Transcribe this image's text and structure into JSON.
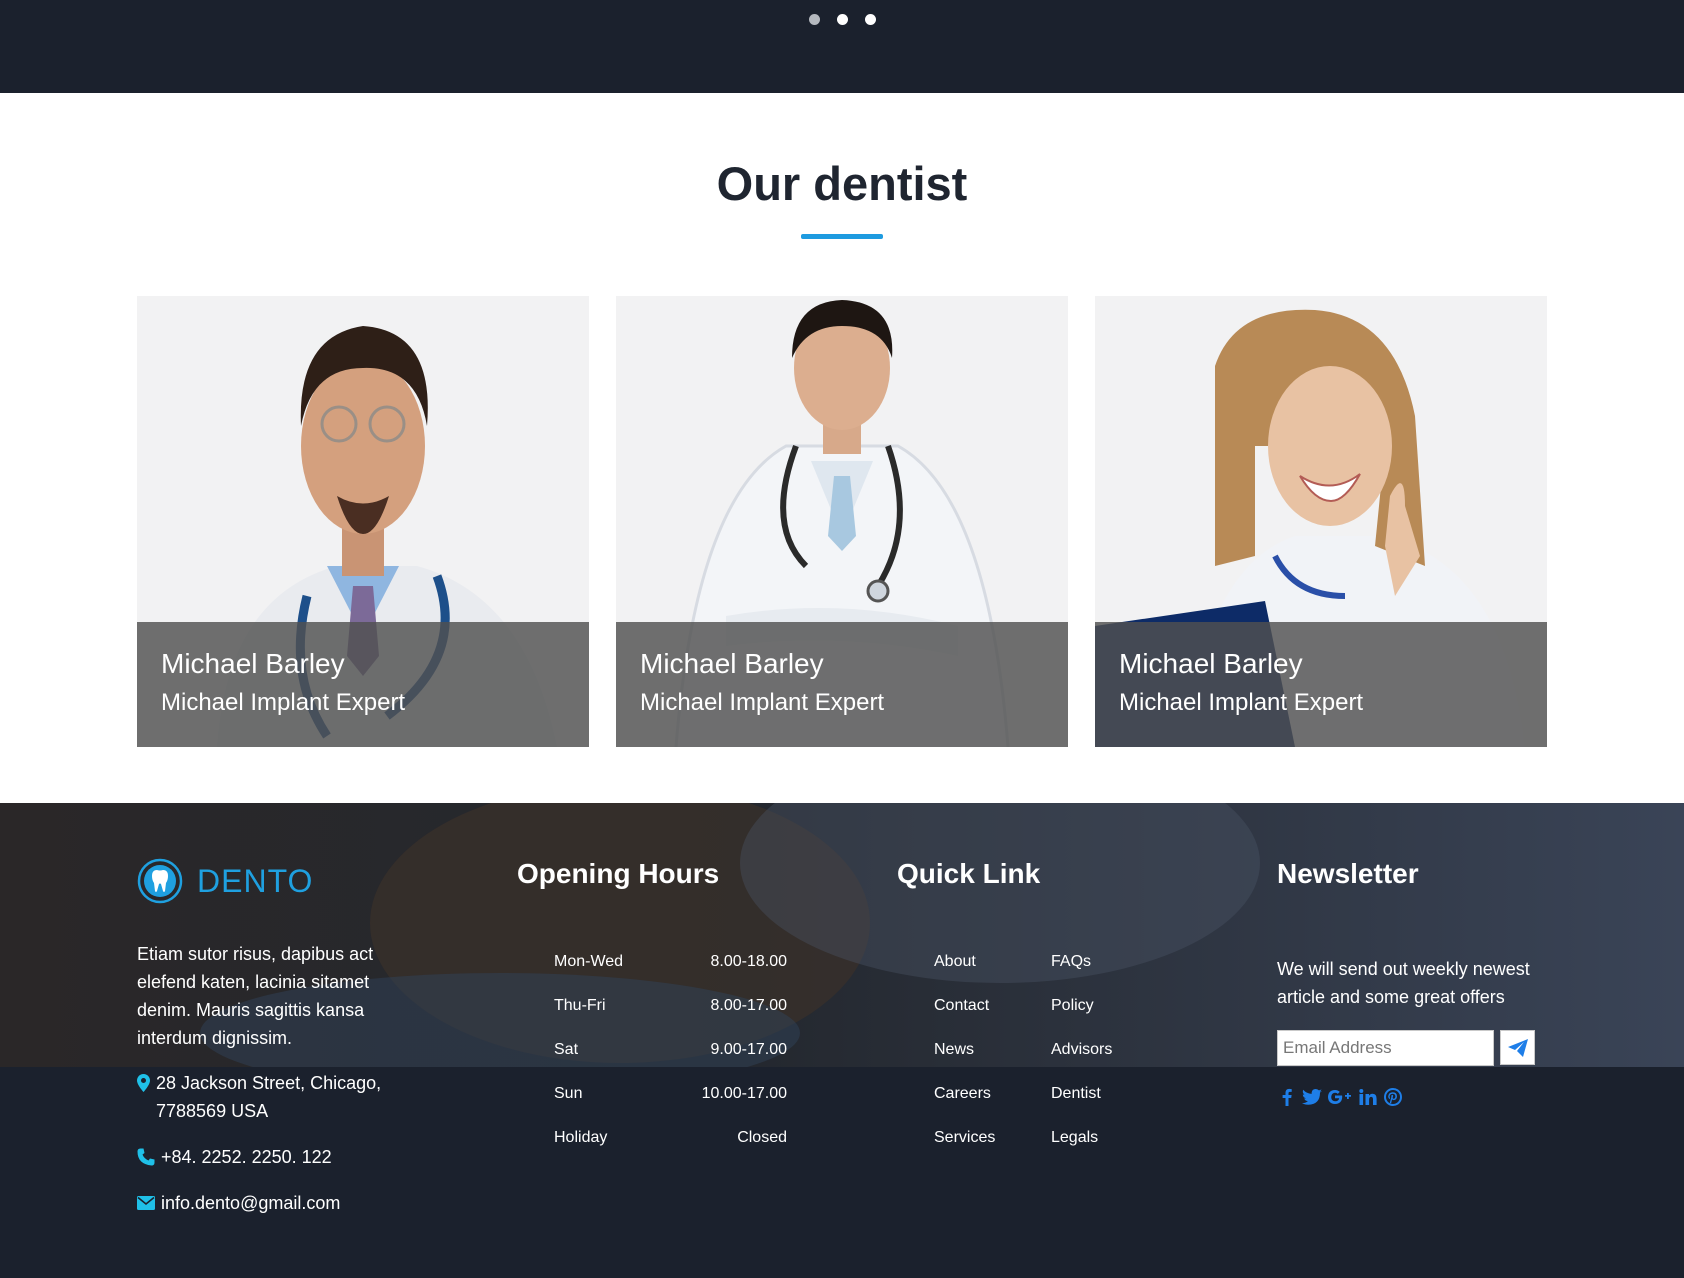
{
  "slider": {
    "dots": [
      "inactive",
      "active",
      "active"
    ]
  },
  "section": {
    "title": "Our dentist"
  },
  "dentists": [
    {
      "name": "Michael Barley",
      "role": "Michael Implant Expert"
    },
    {
      "name": "Michael Barley",
      "role": "Michael Implant Expert"
    },
    {
      "name": "Michael Barley",
      "role": "Michael Implant Expert"
    }
  ],
  "footer": {
    "logo_text": "DENTO",
    "about": "Etiam sutor risus, dapibus act elefend katen, lacinia sitamet denim. Mauris sagittis kansa interdum dignissim.",
    "address": "28 Jackson Street, Chicago, 7788569 USA",
    "phone": "+84. 2252. 2250. 122",
    "email": "info.dento@gmail.com",
    "hours_title": "Opening Hours",
    "hours": [
      {
        "day": "Mon-Wed",
        "time": "8.00-18.00"
      },
      {
        "day": "Thu-Fri",
        "time": "8.00-17.00"
      },
      {
        "day": "Sat",
        "time": "9.00-17.00"
      },
      {
        "day": "Sun",
        "time": "10.00-17.00"
      },
      {
        "day": "Holiday",
        "time": "Closed"
      }
    ],
    "links_title": "Quick Link",
    "links": [
      "About",
      "FAQs",
      "Contact",
      "Policy",
      "News",
      "Advisors",
      "Careers",
      "Dentist",
      "Services",
      "Legals"
    ],
    "newsletter_title": "Newsletter",
    "newsletter_text": "We will send out weekly newest article and some great offers",
    "email_placeholder": "Email Address",
    "socials": [
      "facebook-icon",
      "twitter-icon",
      "google-plus-icon",
      "linkedin-icon",
      "pinterest-icon"
    ]
  },
  "colors": {
    "accent": "#1e9be0",
    "dark": "#1b212d",
    "social": "#1e7ee8"
  }
}
